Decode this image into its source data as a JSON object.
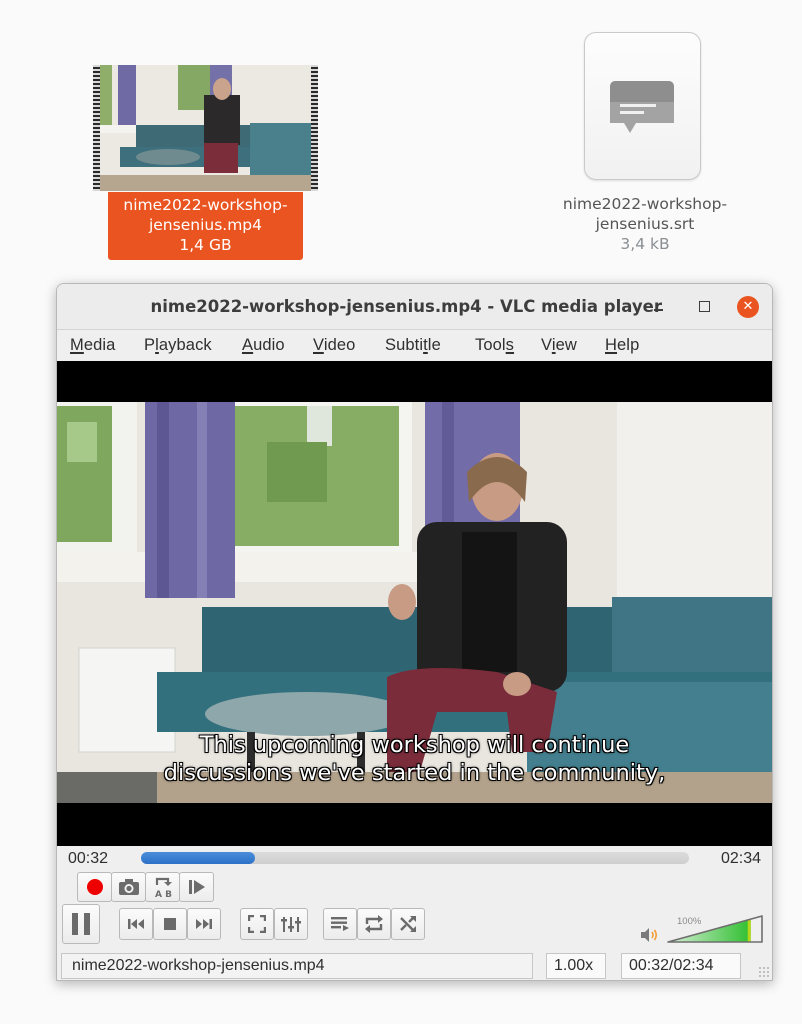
{
  "desktop": {
    "files": [
      {
        "name_line1": "nime2022-workshop-",
        "name_line2": "jensenius.mp4",
        "size": "1,4 GB",
        "type": "video-thumbnail",
        "selected": true
      },
      {
        "name_line1": "nime2022-workshop-",
        "name_line2": "jensenius.srt",
        "size": "3,4 kB",
        "type": "subtitle-file-icon",
        "selected": false
      }
    ],
    "selection_color": "#e95420"
  },
  "window": {
    "title": "nime2022-workshop-jensenius.mp4 - VLC media player",
    "buttons": {
      "minimize_icon": "minimize-icon",
      "maximize_icon": "maximize-icon",
      "close_icon": "close-icon",
      "close_glyph": "✕"
    }
  },
  "menu": {
    "items": [
      {
        "pre": "",
        "key": "M",
        "post": "edia"
      },
      {
        "pre": "P",
        "key": "l",
        "post": "ayback"
      },
      {
        "pre": "",
        "key": "A",
        "post": "udio"
      },
      {
        "pre": "",
        "key": "V",
        "post": "ideo"
      },
      {
        "pre": "Subti",
        "key": "t",
        "post": "le"
      },
      {
        "pre": "Tool",
        "key": "s",
        "post": ""
      },
      {
        "pre": "V",
        "key": "i",
        "post": "ew"
      },
      {
        "pre": "",
        "key": "H",
        "post": "elp"
      }
    ]
  },
  "video": {
    "subtitle_line1": "This upcoming workshop will continue",
    "subtitle_line2": "discussions we've started in the community,"
  },
  "playback": {
    "elapsed": "00:32",
    "total": "02:34",
    "progress_fraction": 0.208,
    "accent_color": "#2c71c7"
  },
  "controls": {
    "advanced": [
      "record-icon",
      "snapshot-icon",
      "ab-loop-icon",
      "frame-by-frame-icon"
    ],
    "main": [
      "pause-icon",
      "previous-icon",
      "stop-icon",
      "next-icon",
      "fullscreen-icon",
      "extended-settings-icon",
      "playlist-icon",
      "loop-icon",
      "shuffle-icon"
    ],
    "volume_label": "100%",
    "volume_fraction": 1.0,
    "volume_color": "#3cc63c"
  },
  "status": {
    "filename": "nime2022-workshop-jensenius.mp4",
    "rate": "1.00x",
    "time": "00:32/02:34"
  }
}
